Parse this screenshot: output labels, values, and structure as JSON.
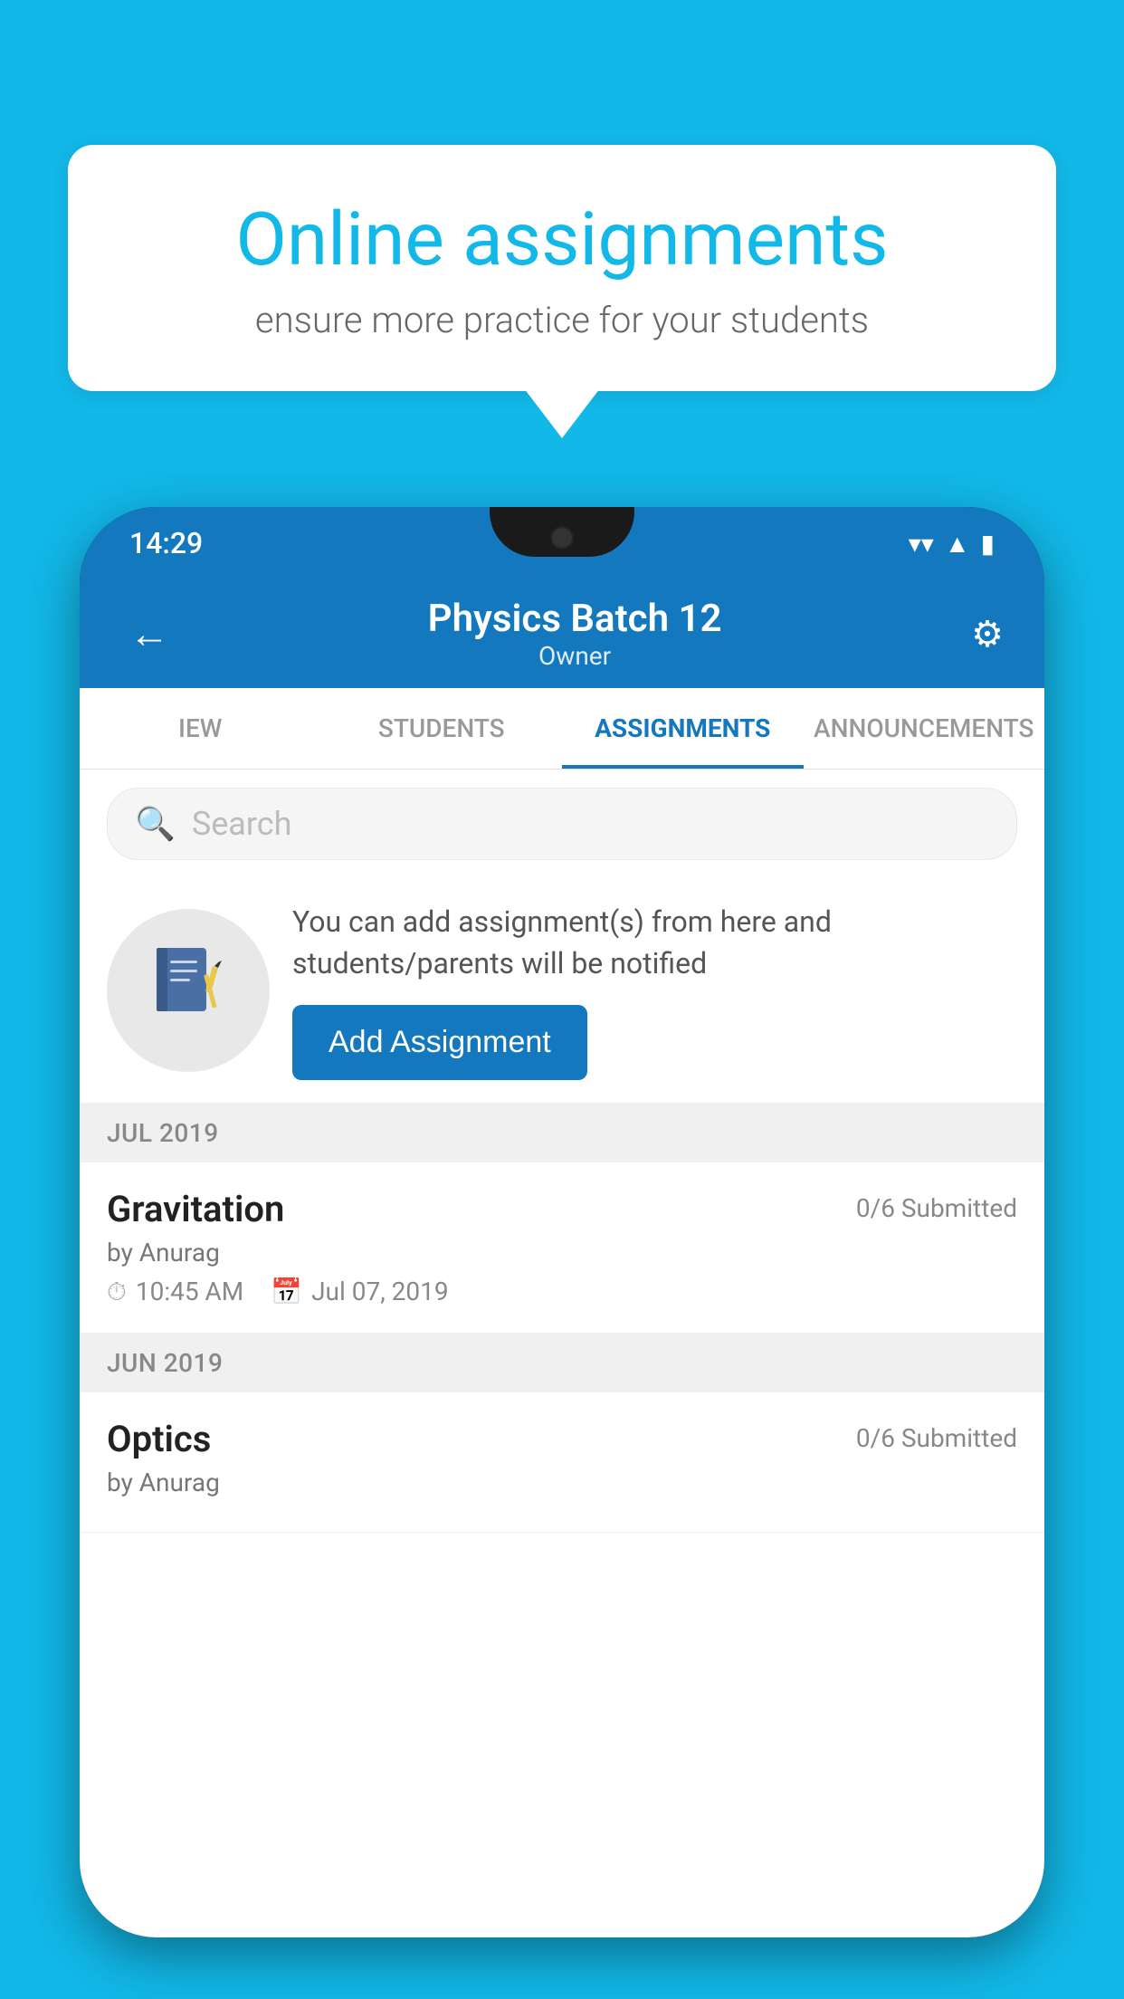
{
  "background_color": "#12B8E8",
  "speech_bubble": {
    "title": "Online assignments",
    "subtitle": "ensure more practice for your students"
  },
  "status_bar": {
    "time": "14:29",
    "icons": [
      "wifi",
      "signal",
      "battery"
    ]
  },
  "app_header": {
    "title": "Physics Batch 12",
    "subtitle": "Owner",
    "back_label": "←",
    "settings_label": "⚙"
  },
  "tabs": [
    {
      "id": "iew",
      "label": "IEW",
      "active": false
    },
    {
      "id": "students",
      "label": "STUDENTS",
      "active": false
    },
    {
      "id": "assignments",
      "label": "ASSIGNMENTS",
      "active": true
    },
    {
      "id": "announcements",
      "label": "ANNOUNCEMENTS",
      "active": false
    }
  ],
  "search": {
    "placeholder": "Search"
  },
  "promo": {
    "text": "You can add assignment(s) from here and students/parents will be notified",
    "button_label": "Add Assignment"
  },
  "sections": [
    {
      "label": "JUL 2019",
      "assignments": [
        {
          "name": "Gravitation",
          "submitted": "0/6 Submitted",
          "author": "by Anurag",
          "time": "10:45 AM",
          "date": "Jul 07, 2019"
        }
      ]
    },
    {
      "label": "JUN 2019",
      "assignments": [
        {
          "name": "Optics",
          "submitted": "0/6 Submitted",
          "author": "by Anurag",
          "time": "",
          "date": ""
        }
      ]
    }
  ],
  "icons": {
    "back": "←",
    "settings": "⚙",
    "search": "🔍",
    "notebook": "📓",
    "clock": "⏱",
    "calendar": "📅"
  }
}
